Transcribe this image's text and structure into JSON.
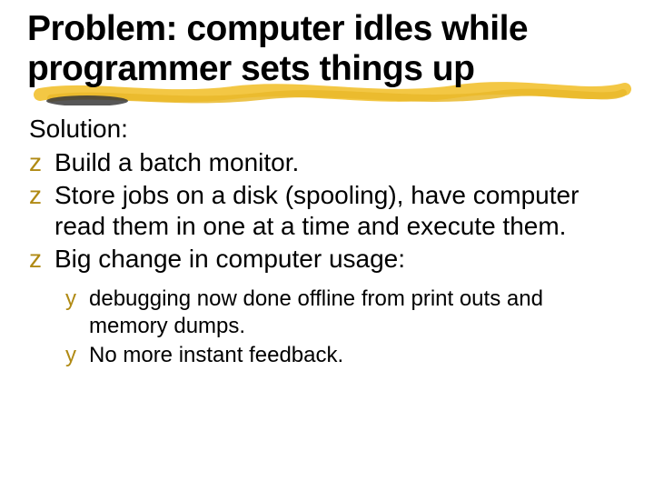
{
  "title": "Problem: computer idles while programmer sets things up",
  "lead": "Solution:",
  "bullets": [
    "Build a batch monitor.",
    " Store jobs on a disk (spooling), have computer read them in one at a time and execute them.",
    "Big change in computer usage:"
  ],
  "subbullets": [
    " debugging now done offline from print outs and memory dumps.",
    " No more instant feedback."
  ],
  "glyphs": {
    "level1": "z",
    "level2": "y"
  }
}
